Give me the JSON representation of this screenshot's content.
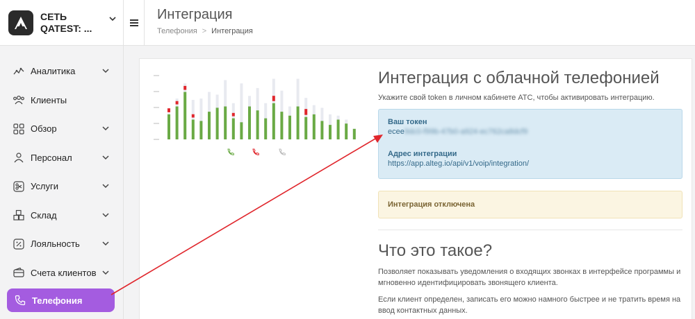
{
  "org": {
    "name": "СЕТЬ QATEST: ..."
  },
  "menu": [
    {
      "label": "Аналитика",
      "icon": "analytics-icon",
      "chevron": true
    },
    {
      "label": "Клиенты",
      "icon": "clients-icon",
      "chevron": false
    },
    {
      "label": "Обзор",
      "icon": "grid-icon",
      "chevron": true
    },
    {
      "label": "Персонал",
      "icon": "person-icon",
      "chevron": true
    },
    {
      "label": "Услуги",
      "icon": "scissors-icon",
      "chevron": true
    },
    {
      "label": "Склад",
      "icon": "boxes-icon",
      "chevron": true
    },
    {
      "label": "Лояльность",
      "icon": "percent-icon",
      "chevron": true
    },
    {
      "label": "Счета клиентов",
      "icon": "wallet-icon",
      "chevron": true
    },
    {
      "label": "Телефония",
      "icon": "phone-icon",
      "chevron": false,
      "active": true
    }
  ],
  "header": {
    "title": "Интеграция",
    "breadcrumb": [
      "Телефония",
      "Интеграция"
    ]
  },
  "integration": {
    "title": "Интеграция с облачной телефонией",
    "subtitle": "Укажите свой token в личном кабинете АТС, чтобы активировать интеграцию.",
    "token_label": "Ваш токен",
    "token_value": "ecee9dc0-f99b-47b0-a924-ec762ca8dcf9",
    "address_label": "Адрес интеграции",
    "address_value": "https://app.alteg.io/api/v1/voip/integration/",
    "status": "Интеграция отключена"
  },
  "about": {
    "title": "Что это такое?",
    "p1": "Позволяет показывать уведомления о входящих звонках в интерфейсе программы и мгновенно идентифицировать звонящего клиента.",
    "p2": "Если клиент определен, записать его можно намного быстрее и не тратить время на ввод контактных данных."
  },
  "illustration": {
    "green_bars": [
      0.38,
      0.5,
      0.72,
      0.3,
      0.28,
      0.42,
      0.48,
      0.5,
      0.32,
      0.26,
      0.5,
      0.44,
      0.32,
      0.55,
      0.42,
      0.36,
      0.5,
      0.34,
      0.38,
      0.28,
      0.22,
      0.3,
      0.24,
      0.16,
      0.12
    ],
    "red_bars": [
      0.06,
      0.05,
      0.06,
      0.05,
      0,
      0,
      0,
      0,
      0.05,
      0,
      0,
      0,
      0,
      0.08,
      0,
      0,
      0,
      0.09,
      0,
      0,
      0,
      0,
      0,
      0,
      0
    ],
    "grey_bars": [
      0.4,
      0.62,
      0.85,
      0.6,
      0.62,
      0.72,
      0.68,
      0.9,
      0.55,
      0.85,
      0.66,
      0.78,
      0.55,
      0.92,
      0.74,
      0.5,
      0.92,
      0.63,
      0.52,
      0.48,
      0.38,
      0.36,
      0.3,
      0.16,
      0.14
    ],
    "colors": {
      "green": "#6aaa45",
      "red": "#e0262c",
      "grey": "#e8eaf0",
      "accent": "#a45ce0"
    }
  }
}
